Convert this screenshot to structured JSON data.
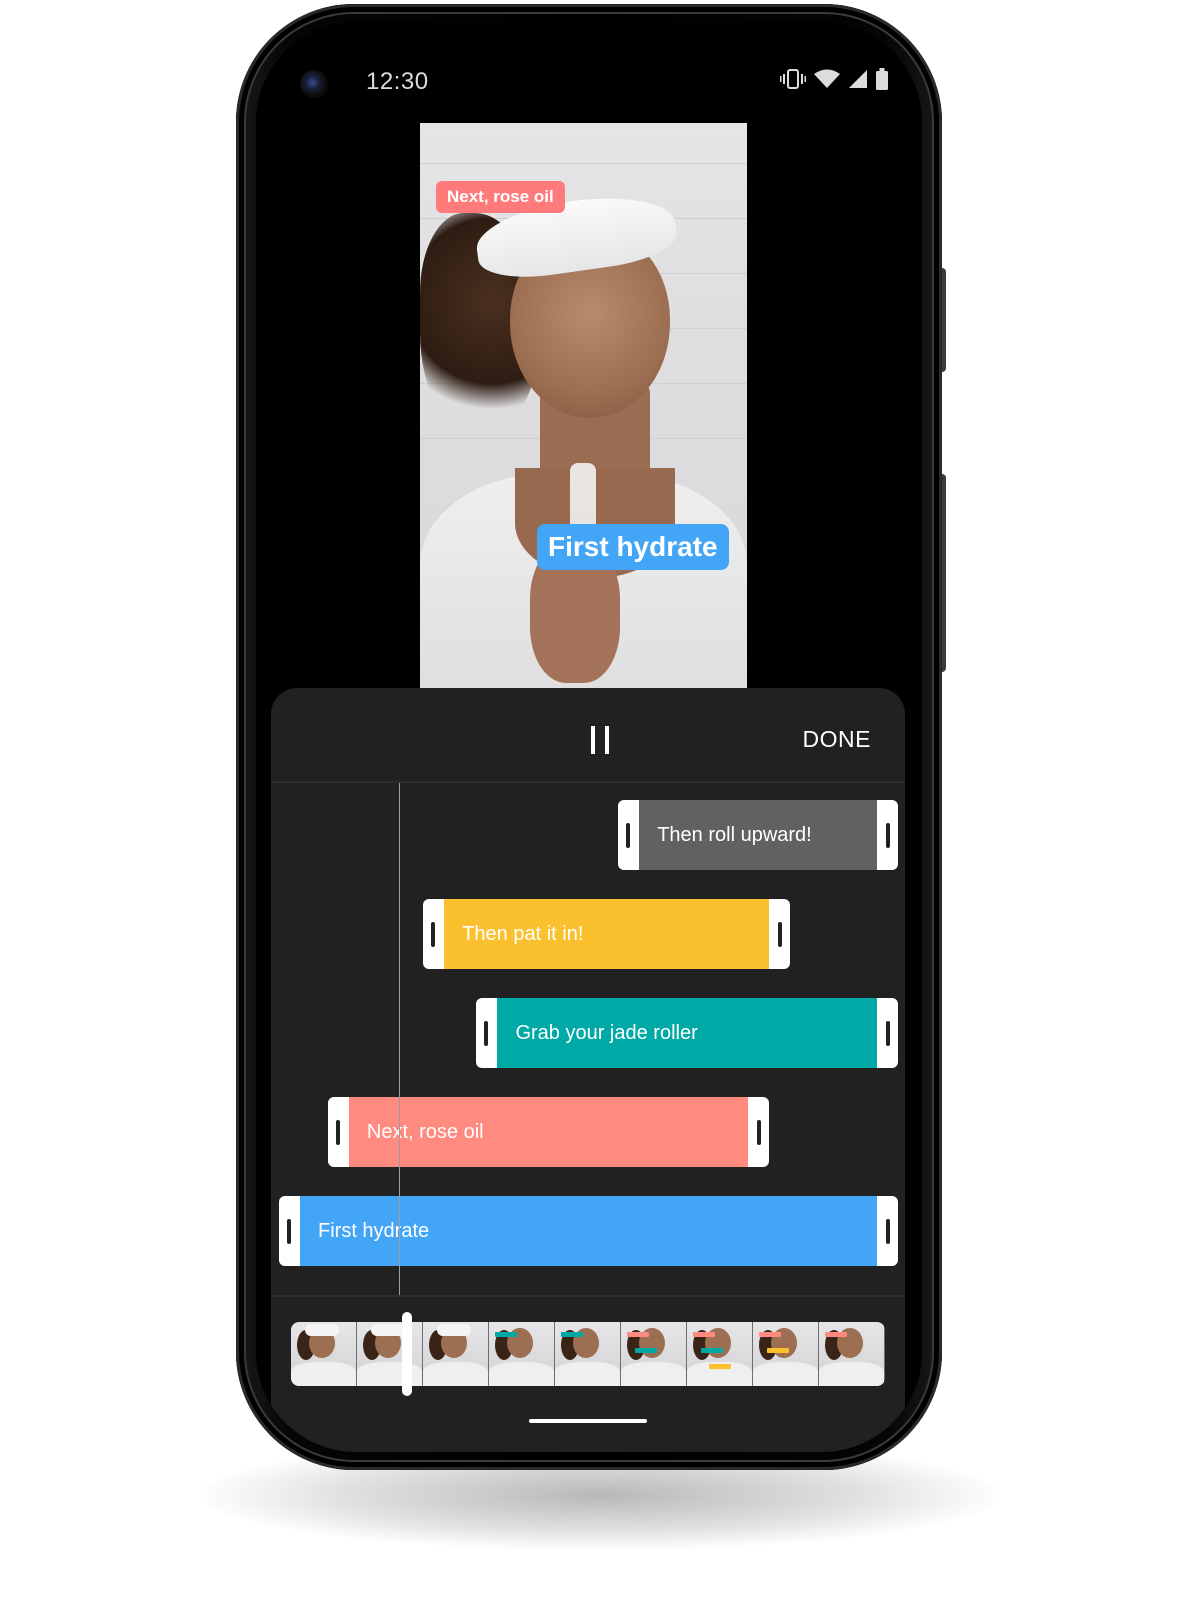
{
  "status_bar": {
    "time": "12:30",
    "icons": [
      "vibrate-icon",
      "wifi-icon",
      "cell-signal-icon",
      "battery-icon"
    ]
  },
  "preview": {
    "overlays": [
      {
        "text": "Next, rose oil",
        "color": "#ff7b7b"
      },
      {
        "text": "First hydrate",
        "color": "#42a5f5"
      }
    ]
  },
  "toolbar": {
    "play_state": "playing",
    "pause_icon": "pause-icon",
    "done_label": "DONE"
  },
  "timeline": {
    "clips": [
      {
        "label": "Then roll upward!",
        "color": "#616161",
        "start": 0.548,
        "end": 1.0
      },
      {
        "label": "Then pat it in!",
        "color": "#fbc02d",
        "start": 0.233,
        "end": 0.825
      },
      {
        "label": "Grab your jade roller",
        "color": "#00a9a5",
        "start": 0.319,
        "end": 1.0
      },
      {
        "label": "Next, rose oil",
        "color": "#ff8a80",
        "start": 0.079,
        "end": 0.792
      },
      {
        "label": "First hydrate",
        "color": "#42a5f5",
        "start": 0.0,
        "end": 1.0
      }
    ],
    "playhead_position": 0.196
  },
  "filmstrip": {
    "frame_count": 9,
    "scrubber_position": 0.196
  },
  "colors": {
    "panel_bg": "#212121",
    "handle": "#ffffff"
  }
}
